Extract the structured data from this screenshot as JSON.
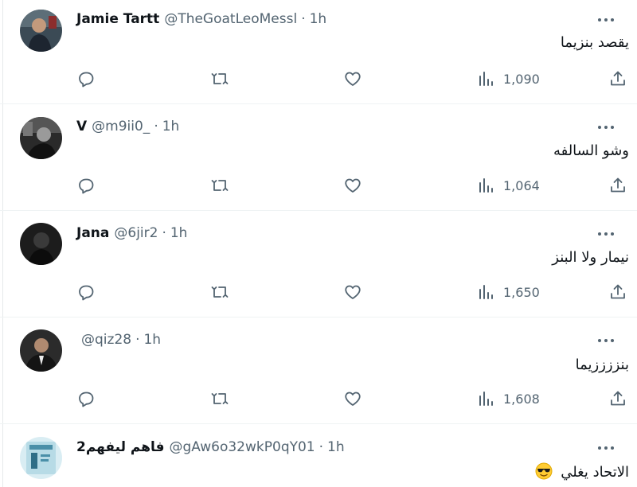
{
  "tweets": [
    {
      "name": "Jamie Tartt",
      "handle": "@TheGoatLeoMessl",
      "separator": "·",
      "time": "1h",
      "text": "يقصد بنزيما",
      "views": "1,090",
      "avatar": "avatar-photo-man"
    },
    {
      "name": "V",
      "handle": "@m9ii0_",
      "separator": "·",
      "time": "1h",
      "text": "وشو السالفه",
      "views": "1,064",
      "avatar": "avatar-photo-bw"
    },
    {
      "name": "Jana",
      "handle": "@6jir2",
      "separator": "·",
      "time": "1h",
      "text": "نيمار ولا البنز",
      "views": "1,650",
      "avatar": "avatar-photo-dark"
    },
    {
      "name": "",
      "handle": "@qiz28",
      "separator": "·",
      "time": "1h",
      "text": "بنززززيما",
      "views": "1,608",
      "avatar": "avatar-photo-suit"
    },
    {
      "name": "فاهم ليفهم2",
      "handle": "@gAw6o32wkP0qY01",
      "separator": "·",
      "time": "1h",
      "text": "الاتحاد يغلي",
      "emoji": "sunglasses-emoji",
      "views": "",
      "avatar": "avatar-photo-blue"
    }
  ],
  "icons": {
    "reply": "reply-icon",
    "retweet": "retweet-icon",
    "like": "like-icon",
    "views": "views-icon",
    "share": "share-icon",
    "more": "more-icon"
  },
  "colors": {
    "text": "#0f1419",
    "secondary": "#536471",
    "border": "#eff3f4"
  }
}
